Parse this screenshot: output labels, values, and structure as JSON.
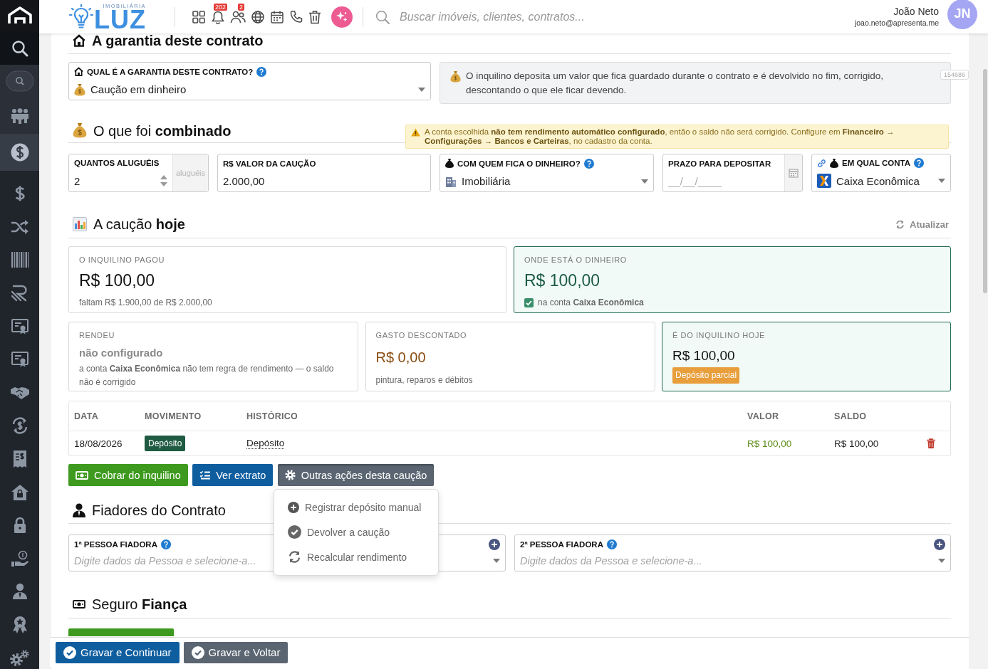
{
  "sidebar": {
    "items": [
      {
        "selected": false
      },
      {
        "selected": false
      },
      {
        "selected": false
      },
      {
        "selected": true
      },
      {
        "selected": false
      },
      {
        "selected": false
      },
      {
        "selected": false
      },
      {
        "selected": false
      },
      {
        "selected": false
      },
      {
        "selected": false
      },
      {
        "selected": false
      },
      {
        "selected": false
      },
      {
        "selected": false
      },
      {
        "selected": false
      },
      {
        "selected": false
      },
      {
        "selected": false
      },
      {
        "selected": false
      },
      {
        "selected": false
      },
      {
        "selected": false
      }
    ]
  },
  "header": {
    "logo": {
      "tagline": "IMOBILIÁRIA",
      "name": "LUZ"
    },
    "notifications_badge": "202",
    "people_badge": "2",
    "search": {
      "placeholder": "Buscar imóveis, clientes, contratos..."
    },
    "user": {
      "name": "João Neto",
      "email": "joao.neto@apresenta.me",
      "initials": "JN"
    }
  },
  "guarantee": {
    "title": "A garantia deste contrato",
    "field": {
      "label": "QUAL É A GARANTIA DESTE CONTRATO?",
      "help": true,
      "value": "Caução em dinheiro"
    },
    "info": "O inquilino deposita um valor que fica guardado durante o contrato e é devolvido no fim, corrigido, descontando o que ele ficar devendo.",
    "record_id": "154686"
  },
  "agreement": {
    "title": "O que foi **combinado**",
    "warning": "A conta escolhida **não tem rendimento automático configurado**, então o saldo não será corrigido. Configure em **Financeiro → Configurações → Bancos e Carteiras**, no cadastro da conta.",
    "fields": [
      {
        "kind": "number",
        "label": "QUANTOS ALUGUÉIS",
        "help": false,
        "value": "2",
        "suffix": "aluguéis"
      },
      {
        "kind": "money",
        "label": "R$ VALOR DA CAUÇÃO",
        "help": false,
        "value": "2.000,00"
      },
      {
        "kind": "select",
        "label": "COM QUEM FICA O DINHEIRO?",
        "help": true,
        "value": "Imobiliária"
      },
      {
        "kind": "date",
        "label": "PRAZO PARA DEPOSITAR",
        "help": false,
        "placeholder": "__/__/____"
      },
      {
        "kind": "select",
        "label": "EM QUAL CONTA",
        "help": true,
        "value": "Caixa Econômica"
      }
    ]
  },
  "balance": {
    "title": "A caução **hoje**",
    "refresh": "Atualizar",
    "rows": [
      [
        {
          "kind": "paid",
          "label": "O INQUILINO PAGOU",
          "amount": "R$ 100,00",
          "note": "faltam R$ 1.900,00 de R$ 2.000,00"
        },
        {
          "kind": "account",
          "label": "ONDE ESTÁ O DINHEIRO",
          "amount": "R$ 100,00",
          "note": "na conta **Caixa Econômica**",
          "checked": true
        }
      ],
      [
        {
          "kind": "yield",
          "label": "RENDEU",
          "amount": "não configurado",
          "note": "a conta **Caixa Econômica** não tem regra de rendimento — o saldo não é corrigido"
        },
        {
          "kind": "expense",
          "label": "GASTO DESCONTADO",
          "amount": "R$ 0,00",
          "note": "pintura, reparos e débitos"
        },
        {
          "kind": "owed",
          "label": "É DO INQUILINO HOJE",
          "amount": "R$ 100,00",
          "badge": "Depósito parcial"
        }
      ]
    ]
  },
  "table": {
    "columns": [
      "DATA",
      "MOVIMENTO",
      "HISTÓRICO",
      "VALOR",
      "SALDO"
    ],
    "rows": [
      {
        "date": "18/08/2026",
        "movement": "Depósito",
        "history": "Depósito",
        "value": "R$ 100,00",
        "balance": "R$ 100,00"
      }
    ]
  },
  "actions": [
    {
      "kind": "success",
      "label": "Cobrar do inquilino"
    },
    {
      "kind": "info",
      "label": "Ver extrato"
    },
    {
      "kind": "secondary",
      "label": "Outras ações desta caução",
      "expanded": true,
      "menu": [
        "Registrar depósito manual",
        "Devolver a caução",
        "Recalcular rendimento"
      ]
    }
  ],
  "guarantors": {
    "title": "Fiadores do Contrato",
    "fields": [
      {
        "label": "1ª PESSOA FIADORA",
        "help": true,
        "placeholder": "Digite dados da Pessoa e selecione-a..."
      },
      {
        "label": "2ª PESSOA FIADORA",
        "help": true,
        "placeholder": "Digite dados da Pessoa e selecione-a..."
      }
    ]
  },
  "insurance": {
    "title": "Seguro **Fiança**"
  },
  "footer": {
    "buttons": [
      {
        "kind": "primary",
        "label": "Gravar e Continuar"
      },
      {
        "kind": "secondary",
        "label": "Gravar e Voltar"
      }
    ]
  }
}
